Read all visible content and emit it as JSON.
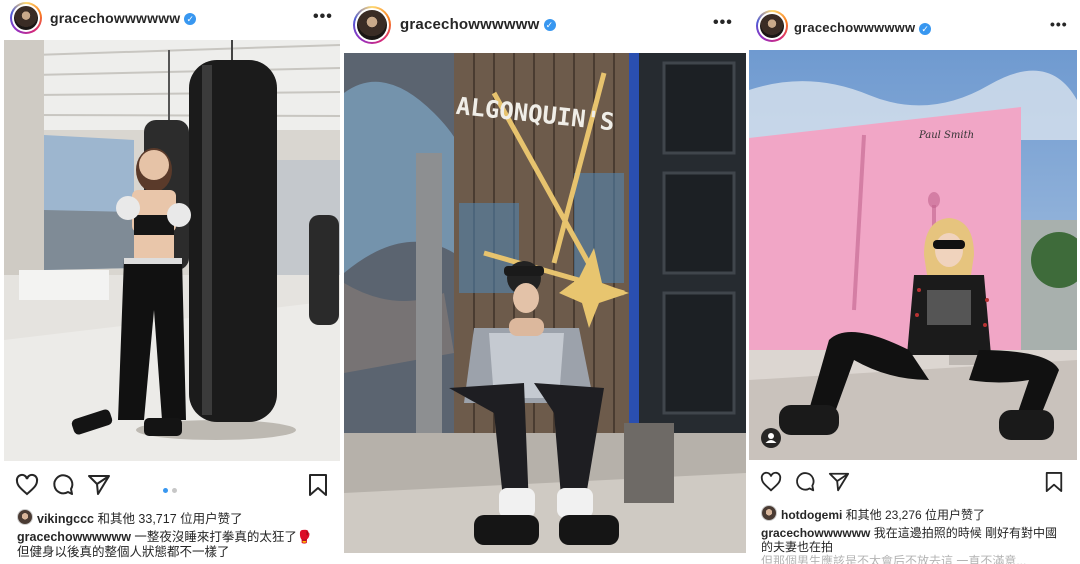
{
  "posts": [
    {
      "username": "gracechowwwwww",
      "verified": true,
      "more": "•••",
      "likes_user": "vikingccc",
      "likes_text": " 和其他 33,717 位用户赞了",
      "caption_user": "gracechowwwwww",
      "caption_text": " 一整夜沒睡來打拳真的太狂了🥊",
      "caption_line2": "但健身以後真的整個人狀態都不一樣了",
      "carousel_pages": 2,
      "carousel_active": 1
    },
    {
      "username": "gracechowwwwww",
      "verified": true,
      "more": "•••",
      "sign_text": "ALGONQUIN'S"
    },
    {
      "username": "gracechowwwwww",
      "verified": true,
      "more": "•••",
      "wall_text": "Paul Smith",
      "likes_user": "hotdogemi",
      "likes_text": " 和其他 23,276 位用户赞了",
      "caption_user": "gracechowwwwww",
      "caption_text": " 我在這邊拍照的時候 剛好有對中國",
      "caption_line2": "的夫妻也在拍",
      "caption_line3": "但那個男生應該是不太會后不放去這 一直不滿意..."
    }
  ],
  "icons": [
    "heart-icon",
    "comment-icon",
    "share-icon",
    "bookmark-icon",
    "verified-icon",
    "more-icon",
    "user-tag-icon"
  ],
  "colors": {
    "accent": "#3897f0",
    "wall_pink": "#f1a6c6",
    "sky": "#8fb3d9"
  }
}
